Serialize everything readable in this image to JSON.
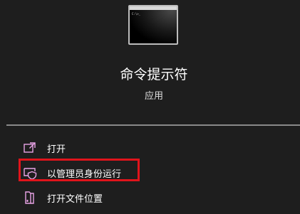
{
  "app": {
    "icon": "command-prompt-icon",
    "icon_prompt_text": "C:\\>_",
    "title": "命令提示符",
    "type": "应用"
  },
  "menu": {
    "items": [
      {
        "label": "打开",
        "icon": "open-external-icon"
      },
      {
        "label": "以管理员身份运行",
        "icon": "shield-admin-icon"
      },
      {
        "label": "打开文件位置",
        "icon": "file-location-icon"
      }
    ]
  },
  "colors": {
    "background": "#1e1e1e",
    "icon_accent": "#e8a3e6",
    "highlight_border": "#e0141b",
    "divider": "#8a8a8a"
  }
}
